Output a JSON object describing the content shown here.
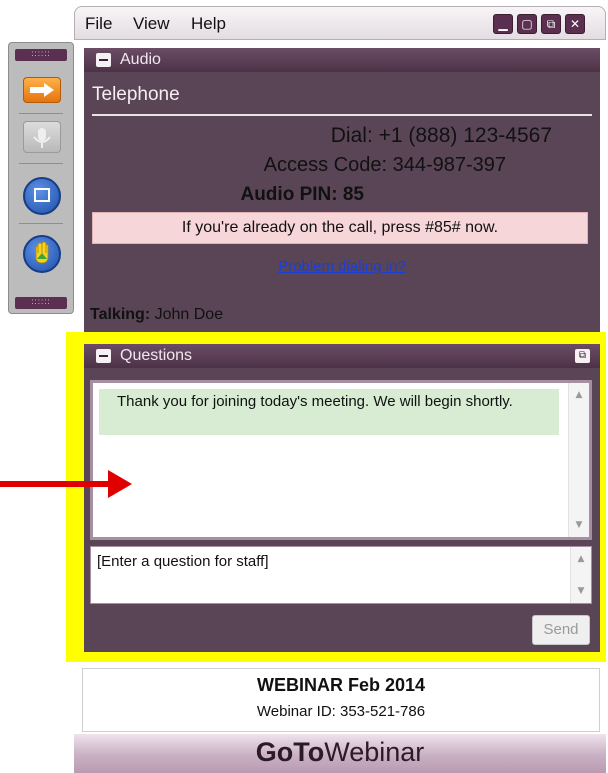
{
  "menu": {
    "file": "File",
    "view": "View",
    "help": "Help"
  },
  "window_buttons": {
    "minimize": "▁",
    "maximize": "▢",
    "restore": "⧉",
    "close": "✕"
  },
  "sidebar": {
    "tools": [
      "arrow-icon",
      "microphone-icon",
      "screen-icon",
      "raise-hand-icon"
    ],
    "accent_color": "#f08a1c",
    "button_color": "#2a5fb5"
  },
  "audio": {
    "title": "Audio",
    "mode_label": "Telephone",
    "dial": "Dial: +1 (888) 123-4567",
    "access_code": "Access Code: 344-987-397",
    "audio_pin": "Audio PIN: 85",
    "pin_notice": "If you're already on the call, press #85# now.",
    "problem_link": "Problem dialing in?",
    "talking_label": "Talking:",
    "talking_name": "John Doe"
  },
  "questions": {
    "title": "Questions",
    "log_message": "Thank you for joining today's meeting. We will begin shortly.",
    "input_placeholder": "[Enter a question for staff]",
    "send_label": "Send"
  },
  "webinar": {
    "title": "WEBINAR Feb 2014",
    "id_line": "Webinar ID: 353-521-786"
  },
  "brand": {
    "part1": "GoTo",
    "part2": "Webinar"
  },
  "colors": {
    "panel": "#594556",
    "highlight": "#ffff00",
    "arrow": "#e00000",
    "notice_bg": "#f6d6d8",
    "message_bg": "#d7ecd3"
  }
}
